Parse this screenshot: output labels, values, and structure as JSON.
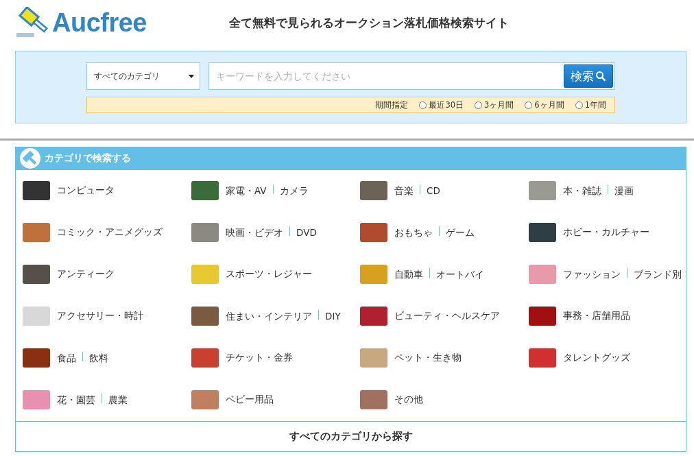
{
  "header": {
    "logo": "Aucfree",
    "tagline": "全て無料で見られるオークション落札価格検索サイト"
  },
  "search": {
    "category": "すべてのカテゴリ",
    "placeholder": "キーワードを入力してください",
    "button": "検索",
    "period": {
      "label": "期間指定",
      "options": [
        {
          "label": "最近30日",
          "selected": false
        },
        {
          "label": "3ヶ月間",
          "selected": false
        },
        {
          "label": "6ヶ月間",
          "selected": false
        },
        {
          "label": "1年間",
          "selected": false
        }
      ]
    }
  },
  "categories": {
    "title": "カテゴリで検索する",
    "items": [
      {
        "parts": [
          "コンピュータ"
        ],
        "color": "#333333"
      },
      {
        "parts": [
          "家電・AV",
          "カメラ"
        ],
        "color": "#3a6b3a"
      },
      {
        "parts": [
          "音楽",
          "CD"
        ],
        "color": "#6b6355"
      },
      {
        "parts": [
          "本・雑誌",
          "漫画"
        ],
        "color": "#9a9a92"
      },
      {
        "parts": [
          "コミック・アニメグッズ"
        ],
        "color": "#c0703a"
      },
      {
        "parts": [
          "映画・ビデオ",
          "DVD"
        ],
        "color": "#8a8a80"
      },
      {
        "parts": [
          "おもちゃ",
          "ゲーム"
        ],
        "color": "#b04a30"
      },
      {
        "parts": [
          "ホビー・カルチャー"
        ],
        "color": "#2f3d45"
      },
      {
        "parts": [
          "アンティーク"
        ],
        "color": "#555048"
      },
      {
        "parts": [
          "スポーツ・レジャー"
        ],
        "color": "#e8c830"
      },
      {
        "parts": [
          "自動車",
          "オートバイ"
        ],
        "color": "#d8a020"
      },
      {
        "parts": [
          "ファッション",
          "ブランド別"
        ],
        "color": "#e89aa8"
      },
      {
        "parts": [
          "アクセサリー・時計"
        ],
        "color": "#d8d8d8"
      },
      {
        "parts": [
          "住まい・インテリア",
          "DIY"
        ],
        "color": "#7a5a40"
      },
      {
        "parts": [
          "ビューティ・ヘルスケア"
        ],
        "color": "#b02030"
      },
      {
        "parts": [
          "事務・店舗用品"
        ],
        "color": "#a01010"
      },
      {
        "parts": [
          "食品",
          "飲料"
        ],
        "color": "#8a3010"
      },
      {
        "parts": [
          "チケット・金券"
        ],
        "color": "#c84030"
      },
      {
        "parts": [
          "ペット・生き物"
        ],
        "color": "#c8a880"
      },
      {
        "parts": [
          "タレントグッズ"
        ],
        "color": "#d03030"
      },
      {
        "parts": [
          "花・園芸",
          "農業"
        ],
        "color": "#e890b0"
      },
      {
        "parts": [
          "ベビー用品"
        ],
        "color": "#c08060"
      },
      {
        "parts": [
          "その他"
        ],
        "color": "#a07060"
      }
    ],
    "all_link": "すべてのカテゴリから探す"
  }
}
